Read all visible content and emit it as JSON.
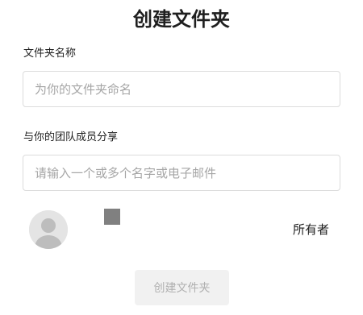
{
  "dialog": {
    "title": "创建文件夹",
    "folder_name": {
      "label": "文件夹名称",
      "placeholder": "为你的文件夹命名",
      "value": ""
    },
    "share": {
      "label": "与你的团队成员分享",
      "placeholder": "请输入一个或多个名字或电子邮件",
      "value": ""
    },
    "members": [
      {
        "avatar_icon": "default-user-avatar-icon",
        "color": "#808080",
        "role": "所有者"
      }
    ],
    "create_button": {
      "label": "创建文件夹",
      "disabled": true
    }
  }
}
